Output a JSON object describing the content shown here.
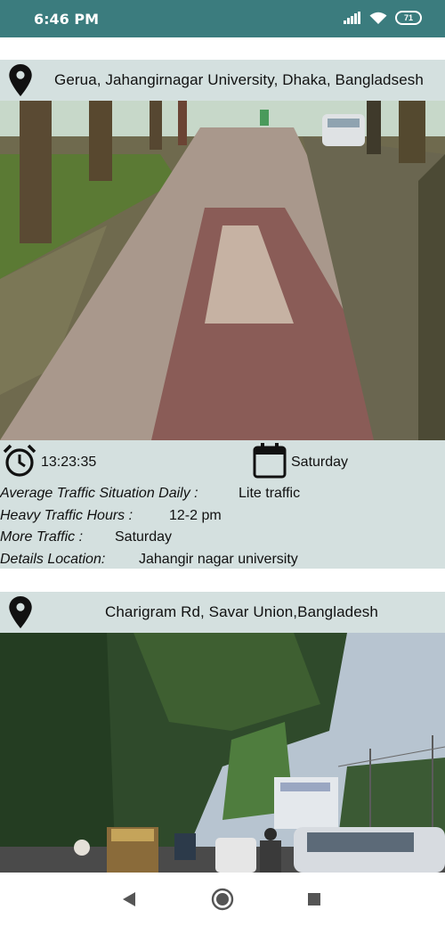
{
  "status": {
    "time": "6:46 PM",
    "battery": "71"
  },
  "cards": [
    {
      "location": "Gerua, Jahangirnagar University, Dhaka, Bangladsesh",
      "time": "13:23:35",
      "day": "Saturday",
      "rows": [
        {
          "label": "Average Traffic Situation Daily :",
          "value": "Lite traffic"
        },
        {
          "label": "Heavy Traffic Hours :",
          "value": "12-2 pm"
        },
        {
          "label": "More Traffic :",
          "value": "Saturday"
        },
        {
          "label": "Details Location:",
          "value": "Jahangir nagar university"
        }
      ]
    },
    {
      "location": "Charigram Rd, Savar Union,Bangladesh"
    }
  ],
  "icons": {
    "pin": "map-pin-icon",
    "clock": "alarm-clock-icon",
    "calendar": "calendar-icon",
    "back": "back-triangle-icon",
    "home": "home-circle-icon",
    "recents": "recents-square-icon"
  }
}
